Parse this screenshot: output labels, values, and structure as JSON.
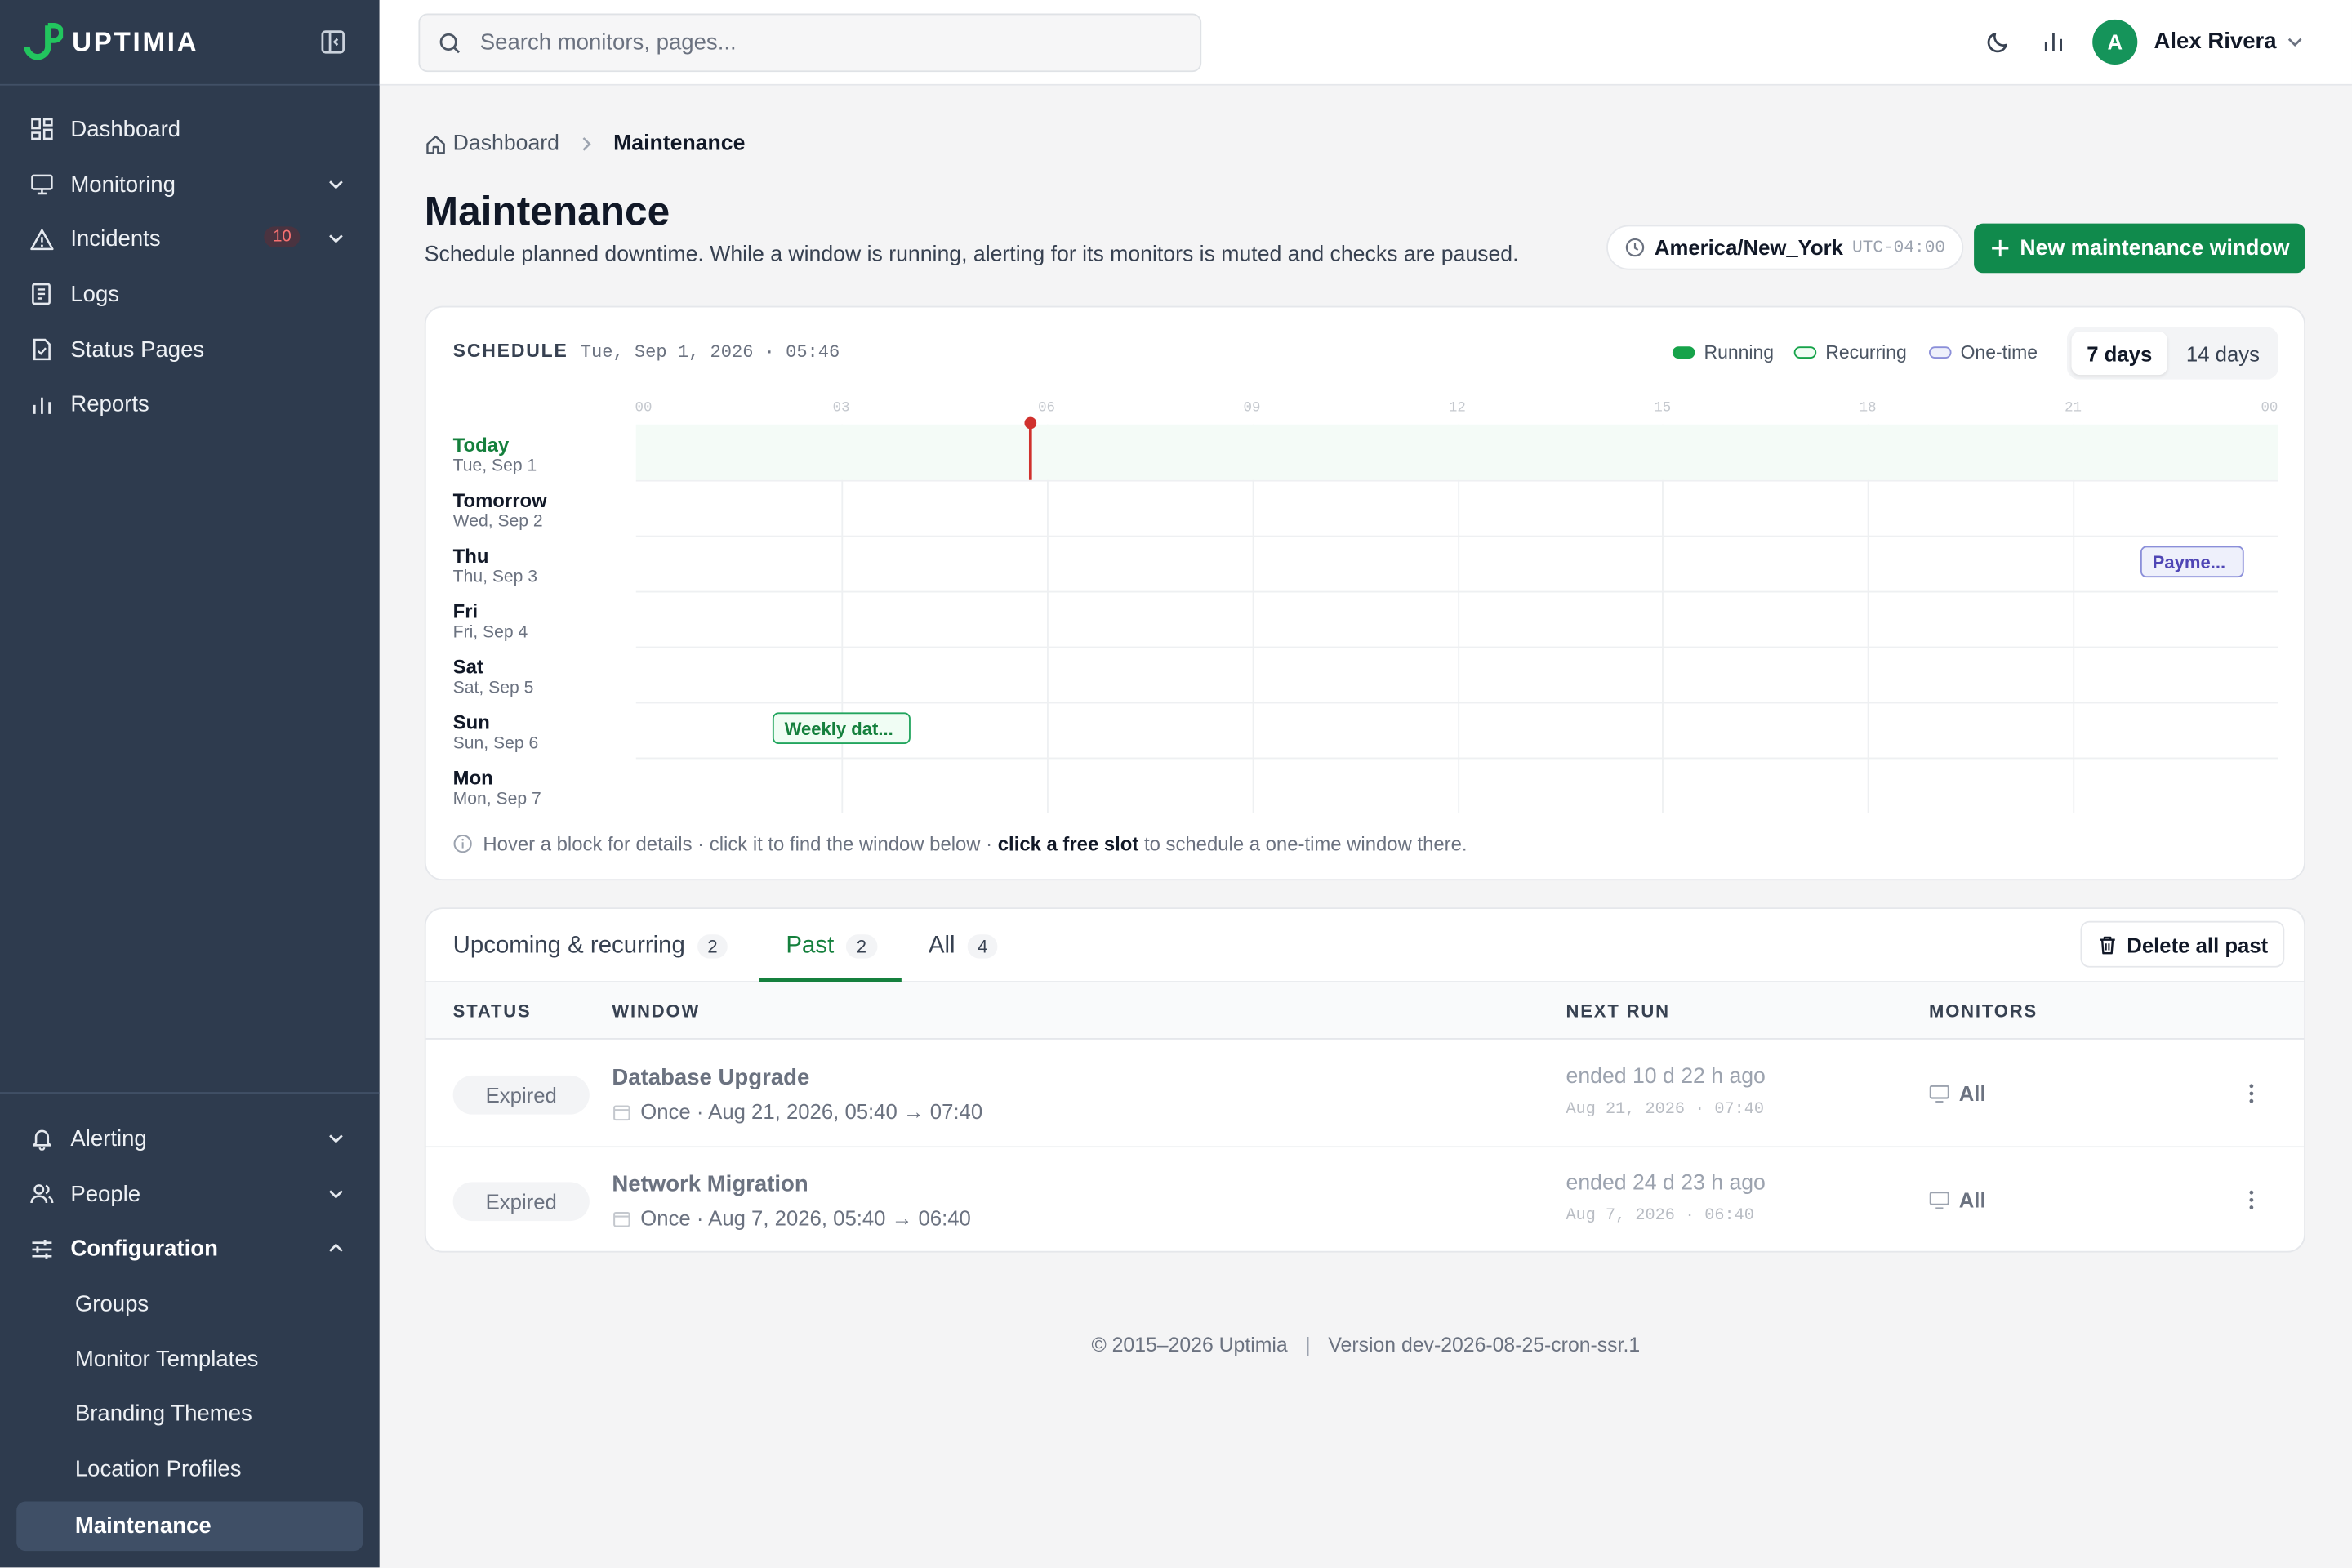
{
  "app": {
    "name": "UPTIMIA"
  },
  "colors": {
    "brand": "#108a4c",
    "sidebar": "#2e3b4e",
    "now_line": "#d0312d",
    "incident_badge": "#f87171"
  },
  "sidebar": {
    "items": [
      {
        "label": "Dashboard",
        "icon": "dashboard-icon"
      },
      {
        "label": "Monitoring",
        "icon": "monitor-icon",
        "expandable": true
      },
      {
        "label": "Incidents",
        "icon": "warning-icon",
        "badge": "10",
        "expandable": true
      },
      {
        "label": "Logs",
        "icon": "logs-icon"
      },
      {
        "label": "Status Pages",
        "icon": "status-page-icon"
      },
      {
        "label": "Reports",
        "icon": "reports-icon"
      }
    ],
    "bottom": [
      {
        "label": "Alerting",
        "icon": "bell-icon"
      },
      {
        "label": "People",
        "icon": "people-icon"
      },
      {
        "label": "Configuration",
        "icon": "sliders-icon"
      }
    ],
    "config_sub": [
      "Groups",
      "Monitor Templates",
      "Branding Themes",
      "Location Profiles",
      "Maintenance"
    ]
  },
  "topbar": {
    "search_placeholder": "Search monitors, pages...",
    "avatar_initial": "A",
    "user_name": "Alex Rivera"
  },
  "breadcrumb": {
    "home": "Dashboard",
    "current": "Maintenance"
  },
  "page": {
    "title": "Maintenance",
    "subtitle": "Schedule planned downtime. While a window is running, alerting for its monitors is muted and checks are paused.",
    "timezone": "America/New_York",
    "utc_offset": "UTC-04:00",
    "new_button": "New maintenance window"
  },
  "schedule": {
    "label": "SCHEDULE",
    "date": "Tue, Sep 1, 2026 · 05:46",
    "legend": [
      "Running",
      "Recurring",
      "One-time"
    ],
    "legend_colors": [
      "#16a34a",
      "#16a34a",
      "#8b8fd9"
    ],
    "range_options": [
      "7 days",
      "14 days"
    ],
    "selected_range": "7 days",
    "hours": [
      "00",
      "03",
      "06",
      "09",
      "12",
      "15",
      "18",
      "21",
      "00"
    ],
    "now_time": "05:46",
    "days": [
      {
        "name": "Today",
        "date": "Tue, Sep 1"
      },
      {
        "name": "Tomorrow",
        "date": "Wed, Sep 2"
      },
      {
        "name": "Thu",
        "date": "Thu, Sep 3"
      },
      {
        "name": "Fri",
        "date": "Fri, Sep 4"
      },
      {
        "name": "Sat",
        "date": "Sat, Sep 5"
      },
      {
        "name": "Sun",
        "date": "Sun, Sep 6"
      },
      {
        "name": "Mon",
        "date": "Mon, Sep 7"
      }
    ],
    "blocks": [
      {
        "label": "Payme...",
        "day": "Thu",
        "kind": "one-time"
      },
      {
        "label": "Weekly dat...",
        "day": "Sun",
        "kind": "recurring"
      }
    ],
    "hint_a": "Hover a block for details · click it to find the window below · ",
    "hint_b": "click a free slot",
    "hint_c": " to schedule a one-time window there."
  },
  "tabs": [
    {
      "label": "Upcoming & recurring",
      "count": "2"
    },
    {
      "label": "Past",
      "count": "2",
      "active": true
    },
    {
      "label": "All",
      "count": "4"
    }
  ],
  "delete_all_label": "Delete all past",
  "table": {
    "columns": [
      "STATUS",
      "WINDOW",
      "NEXT RUN",
      "MONITORS"
    ],
    "rows": [
      {
        "status": "Expired",
        "name": "Database Upgrade",
        "schedule": "Once · Aug 21, 2026, 05:40 → 07:40",
        "next": "ended 10 d 22 h ago",
        "next_sub": "Aug 21, 2026 · 07:40",
        "monitors": "All"
      },
      {
        "status": "Expired",
        "name": "Network Migration",
        "schedule": "Once · Aug 7, 2026, 05:40 → 06:40",
        "next": "ended 24 d 23 h ago",
        "next_sub": "Aug 7, 2026 · 06:40",
        "monitors": "All"
      }
    ]
  },
  "footer": {
    "copyright": "© 2015–2026 Uptimia",
    "version": "Version dev-2026-08-25-cron-ssr.1"
  }
}
